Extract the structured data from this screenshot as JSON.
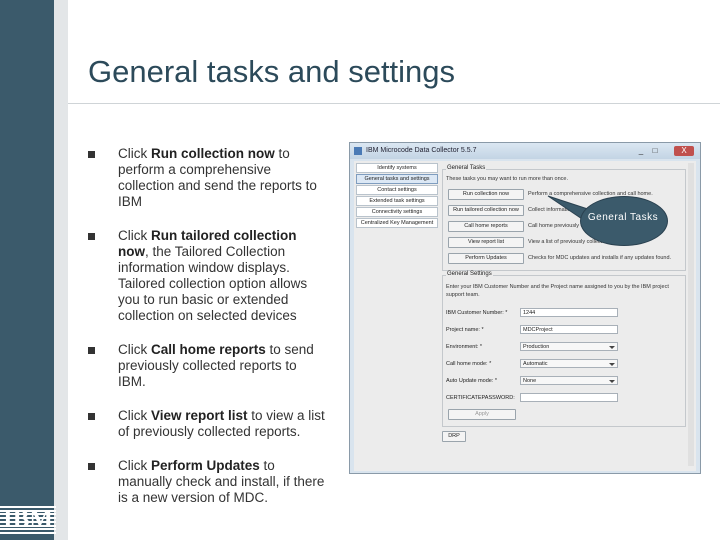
{
  "slide": {
    "title": "General tasks and settings",
    "bullets": [
      {
        "prefix": "Click ",
        "bold": "Run collection now",
        "suffix": " to perform a comprehensive collection and send the reports to IBM"
      },
      {
        "prefix": "Click ",
        "bold": "Run tailored collection now",
        "suffix": ", the Tailored Collection information window displays. Tailored collection option allows you to run basic or extended collection on selected devices"
      },
      {
        "prefix": "Click ",
        "bold": "Call home reports",
        "suffix": " to send previously collected reports to IBM."
      },
      {
        "prefix": "Click ",
        "bold": "View report list",
        "suffix": " to view a list of previously collected reports."
      },
      {
        "prefix": "Click ",
        "bold": "Perform Updates",
        "suffix": " to manually check and install, if there is a new version of MDC."
      }
    ],
    "logo": "IBM",
    "callout": "General Tasks"
  },
  "window": {
    "title": "IBM Microcode Data Collector 5.5.7",
    "controls": {
      "minimize": "_",
      "maximize": "□",
      "close": "X"
    },
    "nav": [
      "Identify systems",
      "General tasks and settings",
      "Contact settings",
      "Extended task settings",
      "Connectivity settings",
      "Centralized Key Management"
    ],
    "general_tasks": {
      "label": "General Tasks",
      "intro": "These tasks you may want to run more than once.",
      "buttons": [
        {
          "label": "Run collection now",
          "desc": "Perform a comprehensive collection and call home."
        },
        {
          "label": "Run tailored collection now",
          "desc": "Collect information on selected devices and call home."
        },
        {
          "label": "Call home reports",
          "desc": "Call home previously collected reports."
        },
        {
          "label": "View report list",
          "desc": "View a list of previously collected reports."
        },
        {
          "label": "Perform Updates",
          "desc": "Checks for MDC updates and installs if any updates found."
        }
      ]
    },
    "general_settings": {
      "label": "General Settings",
      "intro": "Enter your IBM Customer Number and the Project name assigned to you by the IBM project support team.",
      "fields": [
        {
          "label": "IBM Customer Number: *",
          "value": "1244",
          "type": "text"
        },
        {
          "label": "Project name: *",
          "value": "MDCProject",
          "type": "text"
        },
        {
          "label": "Environment: *",
          "value": "Production",
          "type": "select"
        },
        {
          "label": "Call home mode: *",
          "value": "Automatic",
          "type": "select"
        },
        {
          "label": "Auto Update mode: *",
          "value": "None",
          "type": "select"
        },
        {
          "label": "CERTIFICATEPASSWORD:",
          "value": "",
          "type": "text"
        }
      ],
      "apply_label": "Apply"
    },
    "bottom_button": "DRP"
  }
}
